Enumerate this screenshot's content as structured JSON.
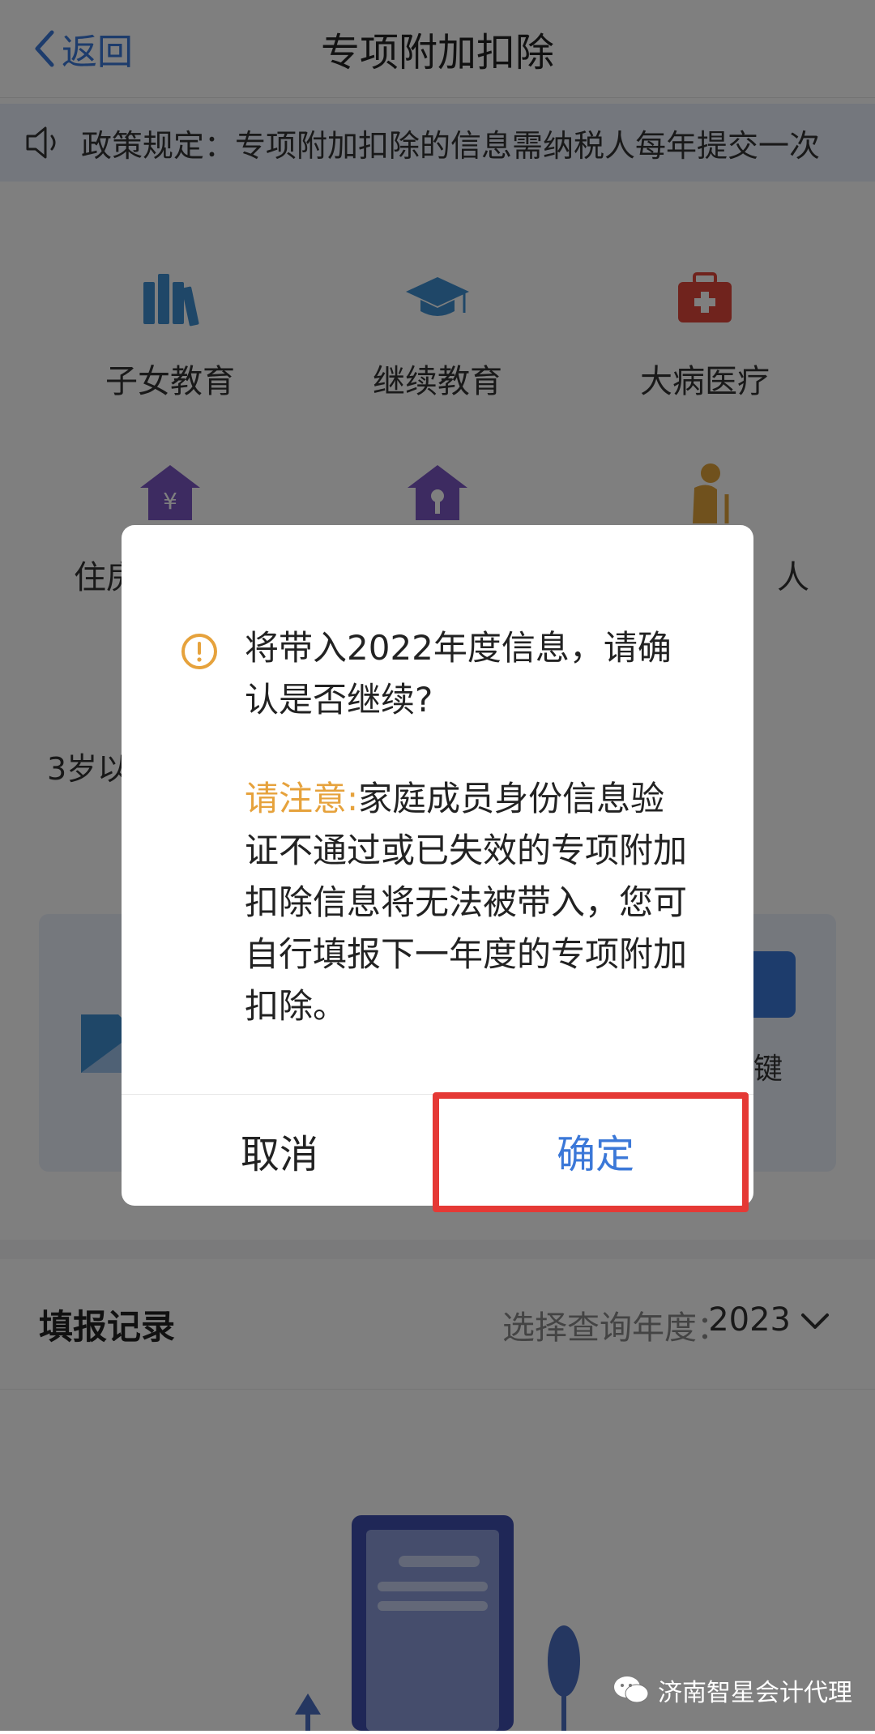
{
  "header": {
    "back_label": "返回",
    "title": "专项附加扣除"
  },
  "notice": {
    "text": "政策规定：专项附加扣除的信息需纳税人每年提交一次"
  },
  "categories": [
    {
      "label": "子女教育",
      "icon": "books-icon",
      "color": "#3f8fd0"
    },
    {
      "label": "继续教育",
      "icon": "graduation-cap-icon",
      "color": "#3f8fd0"
    },
    {
      "label": "大病医疗",
      "icon": "medical-kit-icon",
      "color": "#e0463a"
    },
    {
      "label": "住房贷款利息",
      "visible_prefix": "住房",
      "icon": "house-yen-icon",
      "color": "#7a56c2"
    },
    {
      "label": "住房租金",
      "icon": "house-key-icon",
      "color": "#7a56c2"
    },
    {
      "label": "赡养老人",
      "visible_suffix": "人",
      "icon": "elderly-person-icon",
      "color": "#e0a23a"
    }
  ],
  "partial_text": {
    "left": "3岁以"
  },
  "banner": {
    "tail_text": "键"
  },
  "records": {
    "title": "填报记录",
    "year_label": "选择查询年度：",
    "year_value": "2023"
  },
  "dialog": {
    "message": "将带入2022年度信息，请确认是否继续?",
    "note_label": "请注意:",
    "note_text": "家庭成员身份信息验证不通过或已失效的专项附加扣除信息将无法被带入，您可自行填报下一年度的专项附加扣除。",
    "cancel_label": "取消",
    "confirm_label": "确定"
  },
  "watermark": {
    "text": "济南智星会计代理"
  },
  "colors": {
    "accent": "#3b78d8",
    "warning": "#e6a23c",
    "highlight": "#e53935"
  }
}
